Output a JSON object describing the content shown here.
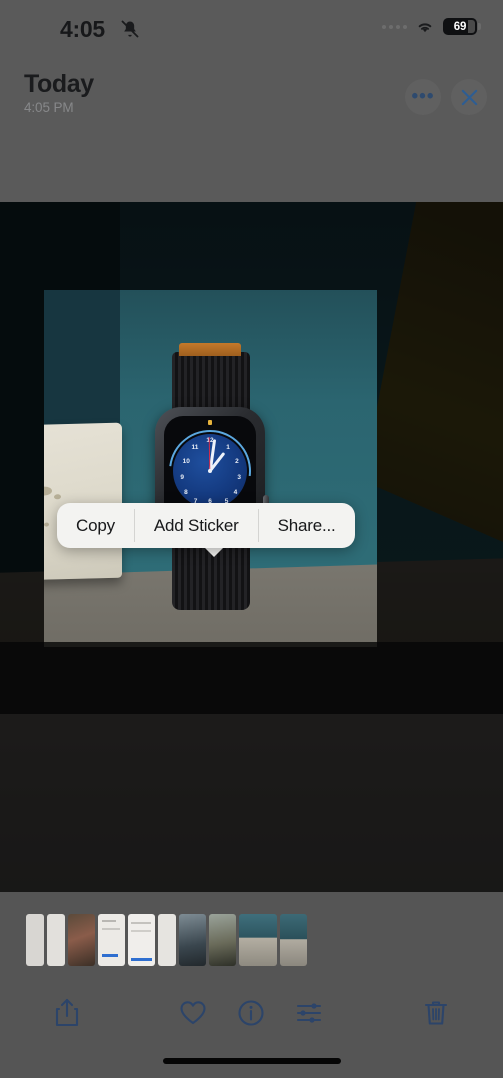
{
  "status_bar": {
    "time": "4:05",
    "mute_icon": "bell-slash-icon",
    "cellular_icon": "cellular-dots-icon",
    "wifi_icon": "wifi-icon",
    "battery_percent": "69",
    "battery_icon": "battery-icon"
  },
  "header": {
    "title": "Today",
    "subtitle": "4:05 PM",
    "more_button_label": "•••",
    "more_icon": "ellipsis-icon",
    "close_icon": "close-x-icon"
  },
  "context_menu": {
    "items": [
      {
        "label": "Copy",
        "name": "menu-item-copy"
      },
      {
        "label": "Add Sticker",
        "name": "menu-item-add-sticker"
      },
      {
        "label": "Share...",
        "name": "menu-item-share"
      }
    ]
  },
  "photo": {
    "subject": "apple-watch-on-counter",
    "watch_face": {
      "numerals": [
        "12",
        "1",
        "2",
        "3",
        "4",
        "5",
        "6",
        "7",
        "8",
        "9",
        "10",
        "11"
      ],
      "dial_color": "#153d84",
      "accent_arc_color": "#5ba8e0",
      "second_hand_color": "#d42a4a"
    },
    "scene_colors": {
      "wall_teal": "#2f6e78",
      "counter_grey": "#7d7a72",
      "floor_cream": "#c9c6b9",
      "olive_object": "#3a3312"
    }
  },
  "filmstrip": {
    "thumbnails": [
      {
        "name": "thumb-doc-1",
        "kind": "document",
        "width": "narrow"
      },
      {
        "name": "thumb-doc-2",
        "kind": "document",
        "width": "narrow"
      },
      {
        "name": "thumb-photo-1",
        "kind": "photo",
        "width": "med"
      },
      {
        "name": "thumb-doc-3",
        "kind": "document",
        "width": "med"
      },
      {
        "name": "thumb-doc-4",
        "kind": "document",
        "width": "med"
      },
      {
        "name": "thumb-doc-5",
        "kind": "document",
        "width": "narrow"
      },
      {
        "name": "thumb-photo-2",
        "kind": "photo",
        "width": "med"
      },
      {
        "name": "thumb-photo-3",
        "kind": "photo",
        "width": "med"
      },
      {
        "name": "thumb-photo-4",
        "kind": "photo",
        "width": "wide"
      },
      {
        "name": "thumb-photo-5",
        "kind": "photo",
        "width": "med"
      }
    ]
  },
  "toolbar": {
    "share_icon": "share-icon",
    "favorite_icon": "heart-icon",
    "info_icon": "info-circle-icon",
    "edit_icon": "adjustments-sliders-icon",
    "delete_icon": "trash-icon",
    "icon_color": "#2c4469"
  },
  "home_indicator": "home-indicator-bar"
}
